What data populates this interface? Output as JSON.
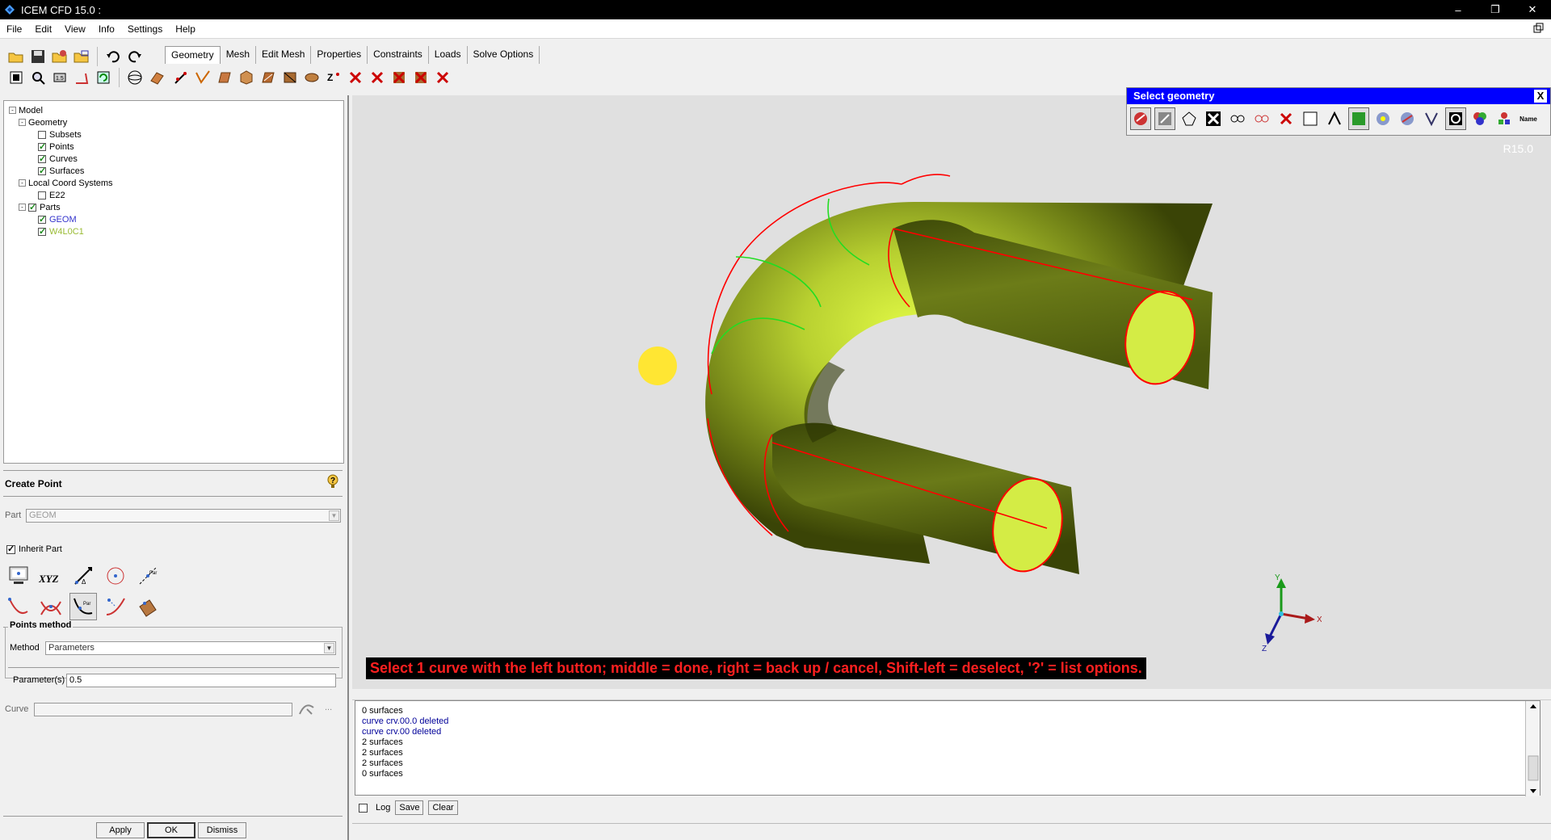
{
  "window": {
    "title": "ICEM CFD 15.0 :",
    "controls": {
      "minimize": "–",
      "maximize": "❐",
      "close": "✕"
    }
  },
  "menu": [
    "File",
    "Edit",
    "View",
    "Info",
    "Settings",
    "Help"
  ],
  "tabs": [
    {
      "label": "Geometry",
      "active": true
    },
    {
      "label": "Mesh"
    },
    {
      "label": "Edit Mesh"
    },
    {
      "label": "Properties"
    },
    {
      "label": "Constraints"
    },
    {
      "label": "Loads"
    },
    {
      "label": "Solve Options"
    }
  ],
  "tree": {
    "nodes": [
      {
        "label": "Model",
        "level": 0,
        "toggle": "-",
        "checked": null,
        "color": "#000"
      },
      {
        "label": "Geometry",
        "level": 1,
        "toggle": "-",
        "checked": null,
        "color": "#000"
      },
      {
        "label": "Subsets",
        "level": 2,
        "toggle": null,
        "checked": false,
        "color": "#000"
      },
      {
        "label": "Points",
        "level": 2,
        "toggle": null,
        "checked": true,
        "color": "#000"
      },
      {
        "label": "Curves",
        "level": 2,
        "toggle": null,
        "checked": true,
        "color": "#000"
      },
      {
        "label": "Surfaces",
        "level": 2,
        "toggle": null,
        "checked": true,
        "color": "#000"
      },
      {
        "label": "Local Coord Systems",
        "level": 1,
        "toggle": "-",
        "checked": null,
        "color": "#000"
      },
      {
        "label": "E22",
        "level": 2,
        "toggle": null,
        "checked": false,
        "color": "#000"
      },
      {
        "label": "Parts",
        "level": 1,
        "toggle": "-",
        "checked": true,
        "color": "#000"
      },
      {
        "label": "GEOM",
        "level": 2,
        "toggle": null,
        "checked": true,
        "color": "#3333cc"
      },
      {
        "label": "W4L0C1",
        "level": 2,
        "toggle": null,
        "checked": true,
        "color": "#99bb33"
      }
    ]
  },
  "create_point": {
    "title": "Create Point",
    "part_label": "Part",
    "part_value": "GEOM",
    "inherit_part_label": "Inherit Part",
    "inherit_part_checked": true,
    "xyz_label": "XYZ",
    "points_method_title": "Points method",
    "method_label": "Method",
    "method_value": "Parameters",
    "parameters_label": "Parameter(s)",
    "parameters_value": "0.5",
    "curve_label": "Curve",
    "curve_value": "",
    "ellipsis": "...",
    "buttons": {
      "apply": "Apply",
      "ok": "OK",
      "dismiss": "Dismiss"
    }
  },
  "select_geometry": {
    "title": "Select geometry",
    "close": "X",
    "name_label": "Name"
  },
  "viewport": {
    "version": "R15.0",
    "prompt": "Select 1 curve with the left button; middle = done, right = back up / cancel, Shift-left = deselect, '?' = list options.",
    "axes": {
      "x": "X",
      "y": "Y",
      "z": "Z"
    }
  },
  "messages": {
    "lines": [
      {
        "text": "0 surfaces",
        "color": "black"
      },
      {
        "text": "curve crv.00.0 deleted",
        "color": "blue"
      },
      {
        "text": "curve crv.00 deleted",
        "color": "blue"
      },
      {
        "text": "2 surfaces",
        "color": "black"
      },
      {
        "text": "2 surfaces",
        "color": "black"
      },
      {
        "text": "2 surfaces",
        "color": "black"
      },
      {
        "text": "0 surfaces",
        "color": "black"
      }
    ],
    "log_label": "Log",
    "log_checked": false,
    "save_label": "Save",
    "clear_label": "Clear"
  },
  "colors": {
    "tube_dark": "#5a6a10",
    "tube_light": "#d8f040",
    "curve_red": "#ff0000",
    "curve_green": "#22dd22",
    "point_yellow": "#ffee33",
    "prompt_text": "#ff2020",
    "select_title_bg": "#0000ff"
  }
}
